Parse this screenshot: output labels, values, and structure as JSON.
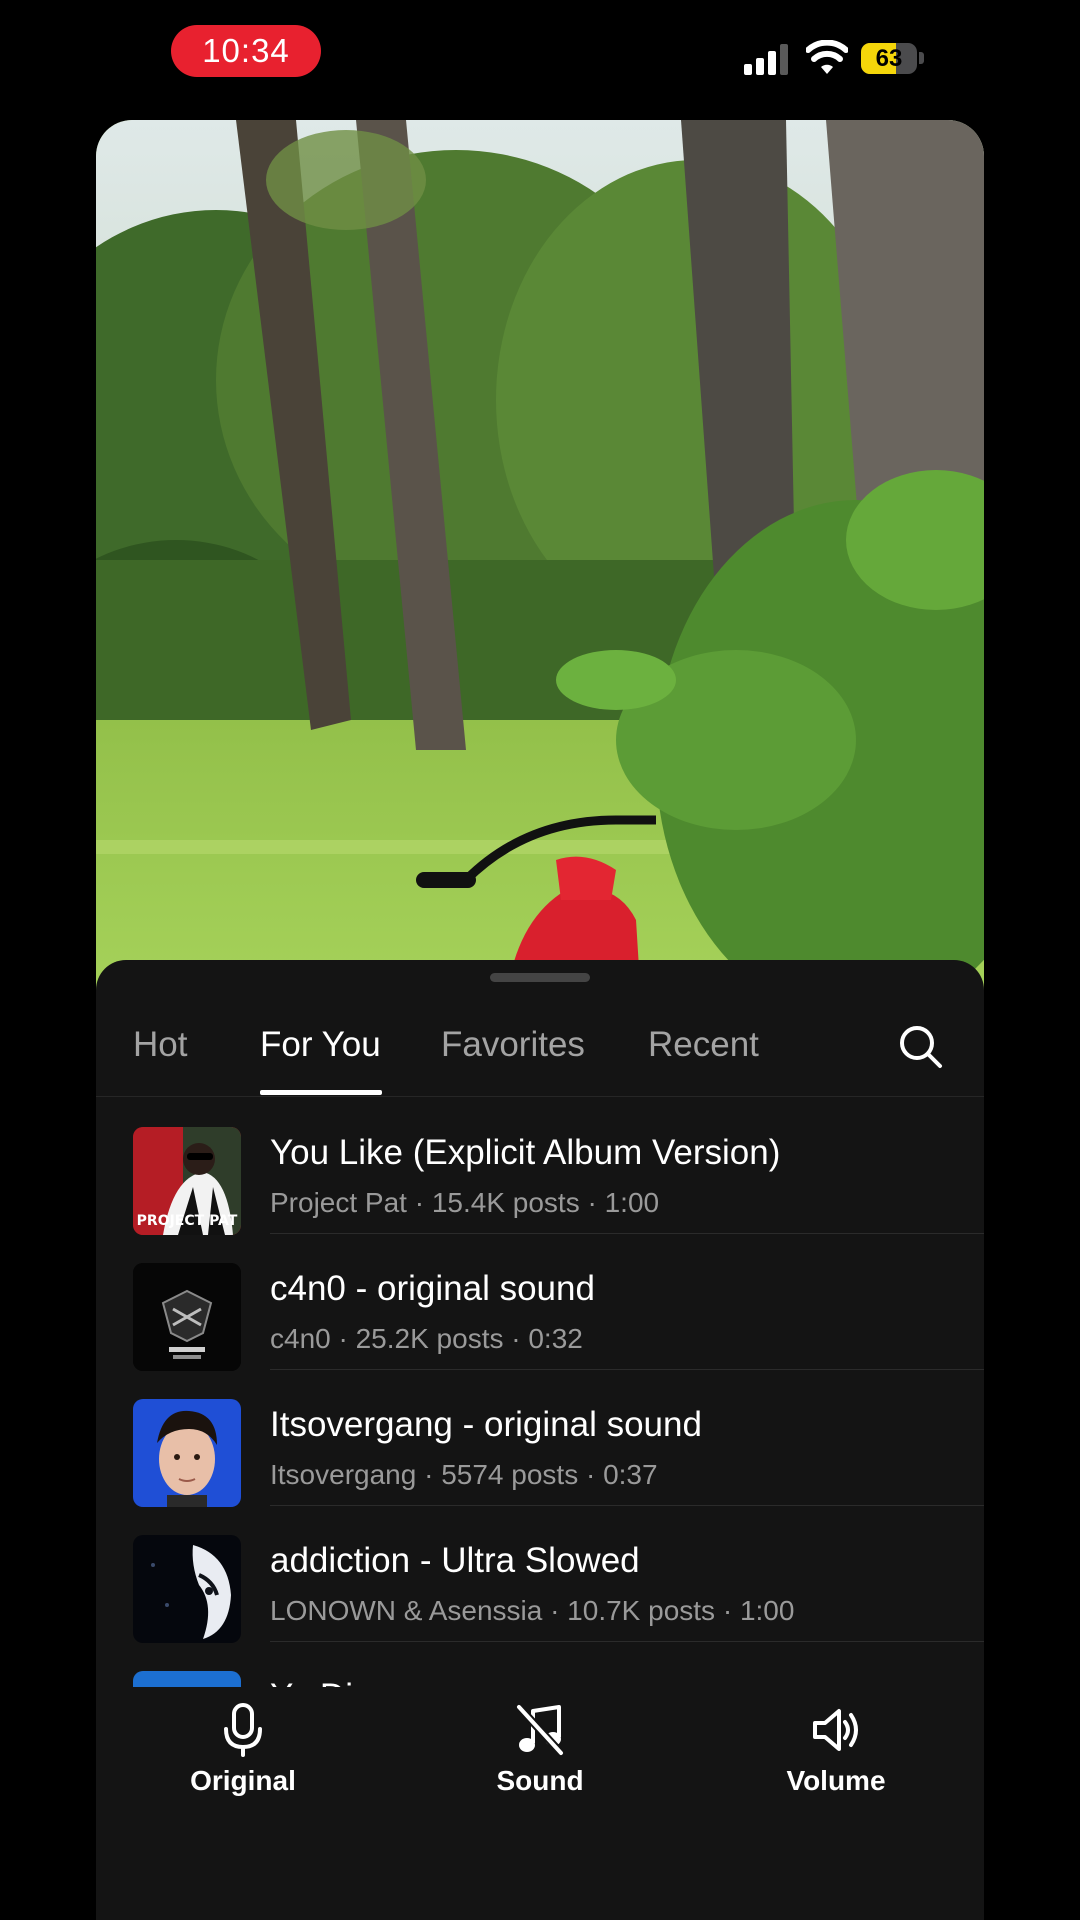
{
  "status_bar": {
    "time": "10:34",
    "battery_level": "63",
    "battery_fraction": 0.63
  },
  "tabs": [
    {
      "label": "Hot",
      "active": false
    },
    {
      "label": "For You",
      "active": true
    },
    {
      "label": "Favorites",
      "active": false
    },
    {
      "label": "Recent",
      "active": false
    }
  ],
  "sounds": [
    {
      "title": "You Like (Explicit Album Version)",
      "subtitle": "Project Pat · 15.4K posts · 1:00",
      "cover_text": "PROJECT PAT"
    },
    {
      "title": "c4n0 - original sound",
      "subtitle": "c4n0 · 25.2K posts · 0:32",
      "cover_text": ""
    },
    {
      "title": "Itsovergang - original sound",
      "subtitle": "Itsovergang · 5574 posts · 0:37",
      "cover_text": ""
    },
    {
      "title": "addiction - Ultra Slowed",
      "subtitle": "LONOWN & Asenssia · 10.7K posts · 1:00",
      "cover_text": ""
    },
    {
      "title": "Ya Digg",
      "subtitle": "",
      "cover_text": ""
    }
  ],
  "bottom_actions": [
    {
      "label": "Original",
      "icon": "microphone-icon"
    },
    {
      "label": "Sound",
      "icon": "music-note-off-icon"
    },
    {
      "label": "Volume",
      "icon": "speaker-volume-icon"
    }
  ],
  "colors": {
    "accent_time_pill": "#e8212f",
    "battery": "#f5d60a",
    "sheet_bg": "#141414"
  }
}
